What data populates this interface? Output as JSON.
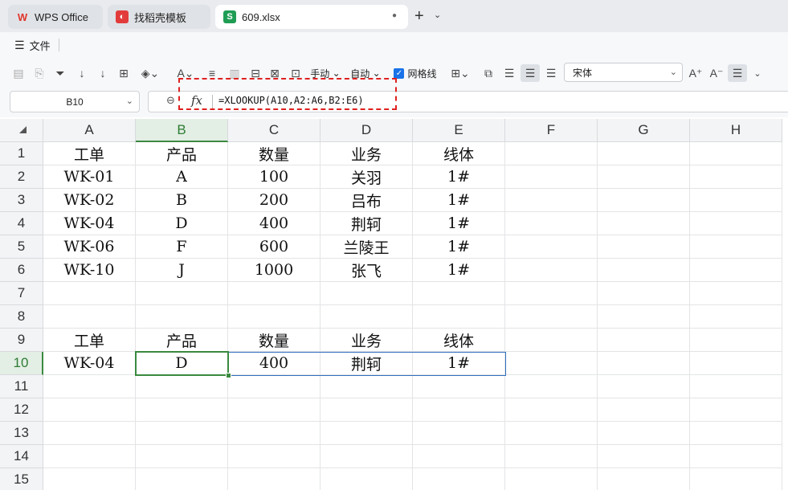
{
  "tabs": [
    {
      "label": "WPS Office",
      "icon": "wps-logo-icon",
      "active": false
    },
    {
      "label": "找稻壳模板",
      "icon": "docer-icon",
      "active": false
    },
    {
      "label": "609.xlsx",
      "icon": "spreadsheet-icon",
      "active": true
    }
  ],
  "menu": {
    "file_label": "文件"
  },
  "toolbar": {
    "manual_label": "手动",
    "auto_label": "自动",
    "gridlines_label": "网格线",
    "gridlines_checked": true,
    "font_name": "宋体"
  },
  "formula_bar": {
    "name_box": "B10",
    "fx": "fx",
    "formula": "=XLOOKUP(A10,A2:A6,B2:E6)"
  },
  "sheet": {
    "columns": [
      "A",
      "B",
      "C",
      "D",
      "E",
      "F",
      "G",
      "H"
    ],
    "rows": [
      "1",
      "2",
      "3",
      "4",
      "5",
      "6",
      "7",
      "8",
      "9",
      "10",
      "11",
      "12",
      "13",
      "14",
      "15"
    ],
    "selected_cell": "B10",
    "cells": [
      [
        "工单",
        "产品",
        "数量",
        "业务",
        "线体"
      ],
      [
        "WK-01",
        "A",
        "100",
        "关羽",
        "1#"
      ],
      [
        "WK-02",
        "B",
        "200",
        "吕布",
        "1#"
      ],
      [
        "WK-04",
        "D",
        "400",
        "荆轲",
        "1#"
      ],
      [
        "WK-06",
        "F",
        "600",
        "兰陵王",
        "1#"
      ],
      [
        "WK-10",
        "J",
        "1000",
        "张飞",
        "1#"
      ],
      [
        "",
        "",
        "",
        "",
        ""
      ],
      [
        "",
        "",
        "",
        "",
        ""
      ],
      [
        "工单",
        "产品",
        "数量",
        "业务",
        "线体"
      ],
      [
        "WK-04",
        "D",
        "400",
        "荆轲",
        "1#"
      ],
      [
        "",
        "",
        "",
        "",
        ""
      ],
      [
        "",
        "",
        "",
        "",
        ""
      ],
      [
        "",
        "",
        "",
        "",
        ""
      ],
      [
        "",
        "",
        "",
        "",
        ""
      ],
      [
        "",
        "",
        "",
        "",
        ""
      ]
    ]
  }
}
